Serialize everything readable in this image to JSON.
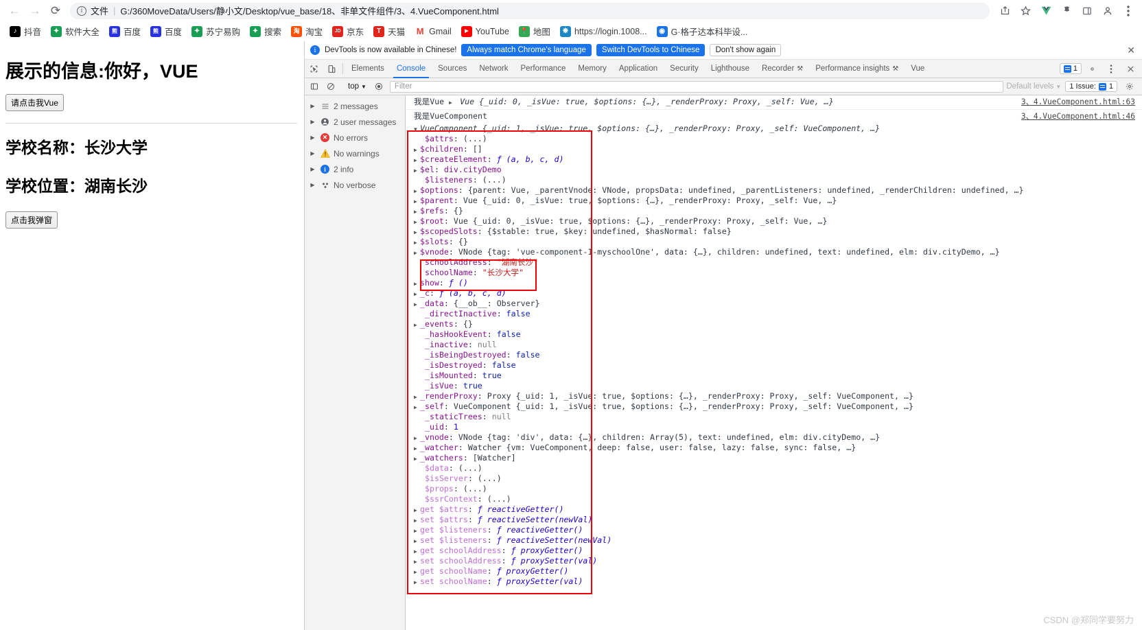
{
  "browser": {
    "nav": {
      "back": "←",
      "forward": "→",
      "reload": "⟳"
    },
    "omnibox": {
      "scheme_label": "文件",
      "url": "G:/360MoveData/Users/静小文/Desktop/vue_base/18、非单文件组件/3、4.VueComponent.html"
    },
    "toolbar_icons": [
      "share-icon",
      "star-icon",
      "vue-devtools-icon",
      "extensions-icon",
      "sidepanel-icon",
      "profile-icon",
      "menu-icon"
    ],
    "bookmarks": [
      {
        "label": "抖音",
        "color": "#000000",
        "glyph": "♪"
      },
      {
        "label": "软件大全",
        "color": "#1a9e55",
        "glyph": "✦"
      },
      {
        "label": "百度",
        "color": "#2932e1",
        "glyph": "熊"
      },
      {
        "label": "百度",
        "color": "#2932e1",
        "glyph": "熊"
      },
      {
        "label": "苏宁易购",
        "color": "#1a9e55",
        "glyph": "✦"
      },
      {
        "label": "搜索",
        "color": "#1a9e55",
        "glyph": "✦"
      },
      {
        "label": "淘宝",
        "color": "#ff5000",
        "glyph": "淘"
      },
      {
        "label": "京东",
        "color": "#e1251b",
        "glyph": "JD"
      },
      {
        "label": "天猫",
        "color": "#e1251b",
        "glyph": "T"
      },
      {
        "label": "Gmail",
        "color": "#ffffff",
        "glyph": "M"
      },
      {
        "label": "YouTube",
        "color": "#ff0000",
        "glyph": "▶"
      },
      {
        "label": "地图",
        "color": "#34a853",
        "glyph": "📍"
      },
      {
        "label": "https://login.1008...",
        "color": "#1e88c7",
        "glyph": "❋"
      },
      {
        "label": "G·格子达本科毕设...",
        "color": "#1a73e8",
        "glyph": "◉"
      }
    ]
  },
  "page": {
    "heading": "展示的信息:你好，VUE",
    "button_vue": "请点击我Vue",
    "school_name_line": "学校名称：长沙大学",
    "school_address_line": "学校位置：湖南长沙",
    "button_popup": "点击我弹窗"
  },
  "devtools": {
    "banner": {
      "message": "DevTools is now available in Chinese!",
      "btn_always": "Always match Chrome's language",
      "btn_switch": "Switch DevTools to Chinese",
      "btn_dismiss": "Don't show again",
      "close": "✕"
    },
    "tabs": [
      {
        "label": "Elements",
        "active": false
      },
      {
        "label": "Console",
        "active": true
      },
      {
        "label": "Sources",
        "active": false
      },
      {
        "label": "Network",
        "active": false
      },
      {
        "label": "Performance",
        "active": false
      },
      {
        "label": "Memory",
        "active": false
      },
      {
        "label": "Application",
        "active": false
      },
      {
        "label": "Security",
        "active": false
      },
      {
        "label": "Lighthouse",
        "active": false
      },
      {
        "label": "Recorder",
        "active": false,
        "badge": "⚒"
      },
      {
        "label": "Performance insights",
        "active": false,
        "badge": "⚒"
      },
      {
        "label": "Vue",
        "active": false
      }
    ],
    "tab_right": {
      "issues_count": "1",
      "settings_icon": "gear-icon",
      "more_icon": "kebab-icon",
      "close_icon": "close-icon"
    },
    "filterbar": {
      "context": "top",
      "filter_placeholder": "Filter",
      "levels_label": "Default levels",
      "issues_label": "1 Issue:",
      "issues_count": "1"
    },
    "sidebar": [
      {
        "label": "2 messages",
        "icon": "list-icon",
        "arrow": true
      },
      {
        "label": "2 user messages",
        "icon": "user-icon",
        "arrow": true
      },
      {
        "label": "No errors",
        "icon": "error-icon",
        "arrow": false
      },
      {
        "label": "No warnings",
        "icon": "warning-icon",
        "arrow": false
      },
      {
        "label": "2 info",
        "icon": "info-icon",
        "arrow": true
      },
      {
        "label": "No verbose",
        "icon": "verbose-icon",
        "arrow": false
      }
    ],
    "console": {
      "msg1_label": "我是Vue",
      "msg1_preview": "Vue {_uid: 0, _isVue: true, $options: {…}, _renderProxy: Proxy, _self: Vue, …}",
      "msg1_source": "3、4.VueComponent.html:63",
      "msg2_label": "我是VueComponent",
      "msg2_source": "3、4.VueComponent.html:46",
      "obj_header": "VueComponent {_uid: 1, _isVue: true, $options: {…}, _renderProxy: Proxy, _self: VueComponent, …}",
      "properties": [
        {
          "arrow": false,
          "key": "$attrs",
          "kcls": "k-prop",
          "value": "(...)",
          "vcls": "k-obj"
        },
        {
          "arrow": true,
          "key": "$children",
          "kcls": "k-prop",
          "value": "[]",
          "vcls": "k-obj"
        },
        {
          "arrow": true,
          "key": "$createElement",
          "kcls": "k-prop",
          "value": "ƒ (a, b, c, d)",
          "vcls": "k-fn"
        },
        {
          "arrow": true,
          "key": "$el",
          "kcls": "k-prop",
          "value": "div.cityDemo",
          "vcls": "k-dom"
        },
        {
          "arrow": false,
          "key": "$listeners",
          "kcls": "k-prop",
          "value": "(...)",
          "vcls": "k-obj"
        },
        {
          "arrow": true,
          "key": "$options",
          "kcls": "k-prop",
          "value": "{parent: Vue, _parentVnode: VNode, propsData: undefined, _parentListeners: undefined, _renderChildren: undefined, …}",
          "vcls": "k-obj"
        },
        {
          "arrow": true,
          "key": "$parent",
          "kcls": "k-prop",
          "value": "Vue {_uid: 0, _isVue: true, $options: {…}, _renderProxy: Proxy, _self: Vue, …}",
          "vcls": "k-obj"
        },
        {
          "arrow": true,
          "key": "$refs",
          "kcls": "k-prop",
          "value": "{}",
          "vcls": "k-obj"
        },
        {
          "arrow": true,
          "key": "$root",
          "kcls": "k-prop",
          "value": "Vue {_uid: 0, _isVue: true, $options: {…}, _renderProxy: Proxy, _self: Vue, …}",
          "vcls": "k-obj"
        },
        {
          "arrow": true,
          "key": "$scopedSlots",
          "kcls": "k-prop",
          "value": "{$stable: true, $key: undefined, $hasNormal: false}",
          "vcls": "k-obj"
        },
        {
          "arrow": true,
          "key": "$slots",
          "kcls": "k-prop",
          "value": "{}",
          "vcls": "k-obj"
        },
        {
          "arrow": true,
          "key": "$vnode",
          "kcls": "k-prop",
          "value": "VNode {tag: 'vue-component-1-myschoolOne', data: {…}, children: undefined, text: undefined, elm: div.cityDemo, …}",
          "vcls": "k-obj"
        },
        {
          "arrow": false,
          "key": "schoolAddress",
          "kcls": "k-prop",
          "value": "\"湖南长沙\"",
          "vcls": "k-str"
        },
        {
          "arrow": false,
          "key": "schoolName",
          "kcls": "k-prop",
          "value": "\"长沙大学\"",
          "vcls": "k-str"
        },
        {
          "arrow": true,
          "key": "show",
          "kcls": "k-prop",
          "value": "ƒ ()",
          "vcls": "k-fn"
        },
        {
          "arrow": true,
          "key": "_c",
          "kcls": "k-prop",
          "value": "ƒ (a, b, c, d)",
          "vcls": "k-fn"
        },
        {
          "arrow": true,
          "key": "_data",
          "kcls": "k-prop",
          "value": "{__ob__: Observer}",
          "vcls": "k-obj"
        },
        {
          "arrow": false,
          "key": "_directInactive",
          "kcls": "k-prop",
          "value": "false",
          "vcls": "k-bool"
        },
        {
          "arrow": true,
          "key": "_events",
          "kcls": "k-prop",
          "value": "{}",
          "vcls": "k-obj"
        },
        {
          "arrow": false,
          "key": "_hasHookEvent",
          "kcls": "k-prop",
          "value": "false",
          "vcls": "k-bool"
        },
        {
          "arrow": false,
          "key": "_inactive",
          "kcls": "k-prop",
          "value": "null",
          "vcls": "k-null"
        },
        {
          "arrow": false,
          "key": "_isBeingDestroyed",
          "kcls": "k-prop",
          "value": "false",
          "vcls": "k-bool"
        },
        {
          "arrow": false,
          "key": "_isDestroyed",
          "kcls": "k-prop",
          "value": "false",
          "vcls": "k-bool"
        },
        {
          "arrow": false,
          "key": "_isMounted",
          "kcls": "k-prop",
          "value": "true",
          "vcls": "k-bool"
        },
        {
          "arrow": false,
          "key": "_isVue",
          "kcls": "k-prop",
          "value": "true",
          "vcls": "k-bool"
        },
        {
          "arrow": true,
          "key": "_renderProxy",
          "kcls": "k-prop",
          "value": "Proxy {_uid: 1, _isVue: true, $options: {…}, _renderProxy: Proxy, _self: VueComponent, …}",
          "vcls": "k-obj"
        },
        {
          "arrow": true,
          "key": "_self",
          "kcls": "k-prop",
          "value": "VueComponent {_uid: 1, _isVue: true, $options: {…}, _renderProxy: Proxy, _self: VueComponent, …}",
          "vcls": "k-obj"
        },
        {
          "arrow": false,
          "key": "_staticTrees",
          "kcls": "k-prop",
          "value": "null",
          "vcls": "k-null"
        },
        {
          "arrow": false,
          "key": "_uid",
          "kcls": "k-prop",
          "value": "1",
          "vcls": "k-num"
        },
        {
          "arrow": true,
          "key": "_vnode",
          "kcls": "k-prop",
          "value": "VNode {tag: 'div', data: {…}, children: Array(5), text: undefined, elm: div.cityDemo, …}",
          "vcls": "k-obj"
        },
        {
          "arrow": true,
          "key": "_watcher",
          "kcls": "k-prop",
          "value": "Watcher {vm: VueComponent, deep: false, user: false, lazy: false, sync: false, …}",
          "vcls": "k-obj"
        },
        {
          "arrow": true,
          "key": "_watchers",
          "kcls": "k-prop",
          "value": "[Watcher]",
          "vcls": "k-obj"
        },
        {
          "arrow": false,
          "key": "$data",
          "kcls": "k-prop-dim",
          "value": "(...)",
          "vcls": "k-obj"
        },
        {
          "arrow": false,
          "key": "$isServer",
          "kcls": "k-prop-dim",
          "value": "(...)",
          "vcls": "k-obj"
        },
        {
          "arrow": false,
          "key": "$props",
          "kcls": "k-prop-dim",
          "value": "(...)",
          "vcls": "k-obj"
        },
        {
          "arrow": false,
          "key": "$ssrContext",
          "kcls": "k-prop-dim",
          "value": "(...)",
          "vcls": "k-obj"
        },
        {
          "arrow": true,
          "key": "get $attrs",
          "kcls": "k-prop-dim",
          "value": "ƒ reactiveGetter()",
          "vcls": "k-fn"
        },
        {
          "arrow": true,
          "key": "set $attrs",
          "kcls": "k-prop-dim",
          "value": "ƒ reactiveSetter(newVal)",
          "vcls": "k-fn"
        },
        {
          "arrow": true,
          "key": "get $listeners",
          "kcls": "k-prop-dim",
          "value": "ƒ reactiveGetter()",
          "vcls": "k-fn"
        },
        {
          "arrow": true,
          "key": "set $listeners",
          "kcls": "k-prop-dim",
          "value": "ƒ reactiveSetter(newVal)",
          "vcls": "k-fn"
        },
        {
          "arrow": true,
          "key": "get schoolAddress",
          "kcls": "k-prop-dim",
          "value": "ƒ proxyGetter()",
          "vcls": "k-fn"
        },
        {
          "arrow": true,
          "key": "set schoolAddress",
          "kcls": "k-prop-dim",
          "value": "ƒ proxySetter(val)",
          "vcls": "k-fn"
        },
        {
          "arrow": true,
          "key": "get schoolName",
          "kcls": "k-prop-dim",
          "value": "ƒ proxyGetter()",
          "vcls": "k-fn"
        },
        {
          "arrow": true,
          "key": "set schoolName",
          "kcls": "k-prop-dim",
          "value": "ƒ proxySetter(val)",
          "vcls": "k-fn"
        }
      ]
    }
  },
  "watermark": "CSDN @郑同学要努力",
  "colors": {
    "accent": "#1a73e8",
    "annotation": "#ee0000"
  }
}
